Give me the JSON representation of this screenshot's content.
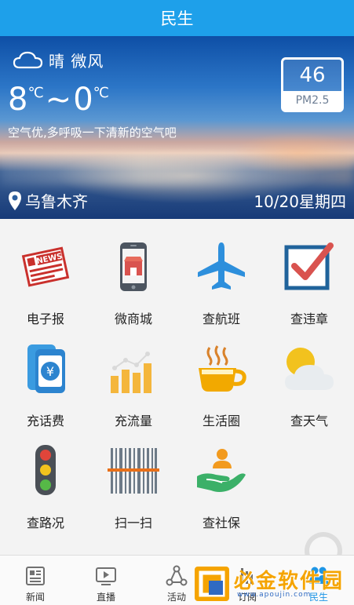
{
  "header": {
    "title": "民生"
  },
  "weather": {
    "condition": "晴 微风",
    "temp_high": "8",
    "temp_low": "0",
    "unit": "℃",
    "separator": "~",
    "advice": "空气优,多呼吸一下清新的空气吧",
    "pm_value": "46",
    "pm_label": "PM2.5",
    "city": "乌鲁木齐",
    "date": "10/20星期四"
  },
  "services": [
    {
      "label": "电子报",
      "icon": "newspaper-icon"
    },
    {
      "label": "微商城",
      "icon": "phone-shop-icon"
    },
    {
      "label": "查航班",
      "icon": "airplane-icon"
    },
    {
      "label": "查违章",
      "icon": "checkbox-icon"
    },
    {
      "label": "充话费",
      "icon": "phone-yuan-icon"
    },
    {
      "label": "充流量",
      "icon": "bar-chart-icon"
    },
    {
      "label": "生活圈",
      "icon": "coffee-cup-icon"
    },
    {
      "label": "查天气",
      "icon": "sun-cloud-icon"
    },
    {
      "label": "查路况",
      "icon": "traffic-light-icon"
    },
    {
      "label": "扫一扫",
      "icon": "barcode-icon"
    },
    {
      "label": "查社保",
      "icon": "hand-person-icon"
    }
  ],
  "tabs": [
    {
      "label": "新闻",
      "icon": "news-icon",
      "active": false
    },
    {
      "label": "直播",
      "icon": "play-icon",
      "active": false
    },
    {
      "label": "活动",
      "icon": "activity-icon",
      "active": false
    },
    {
      "label": "订阅",
      "icon": "subscribe-icon",
      "active": false
    },
    {
      "label": "民生",
      "icon": "people-icon",
      "active": true
    }
  ],
  "watermark": {
    "text": "必金软件园",
    "url": "www.apoujin.com"
  },
  "colors": {
    "primary": "#1ea0ea",
    "active_tab": "#1e96e6",
    "watermark": "#f5a400"
  }
}
